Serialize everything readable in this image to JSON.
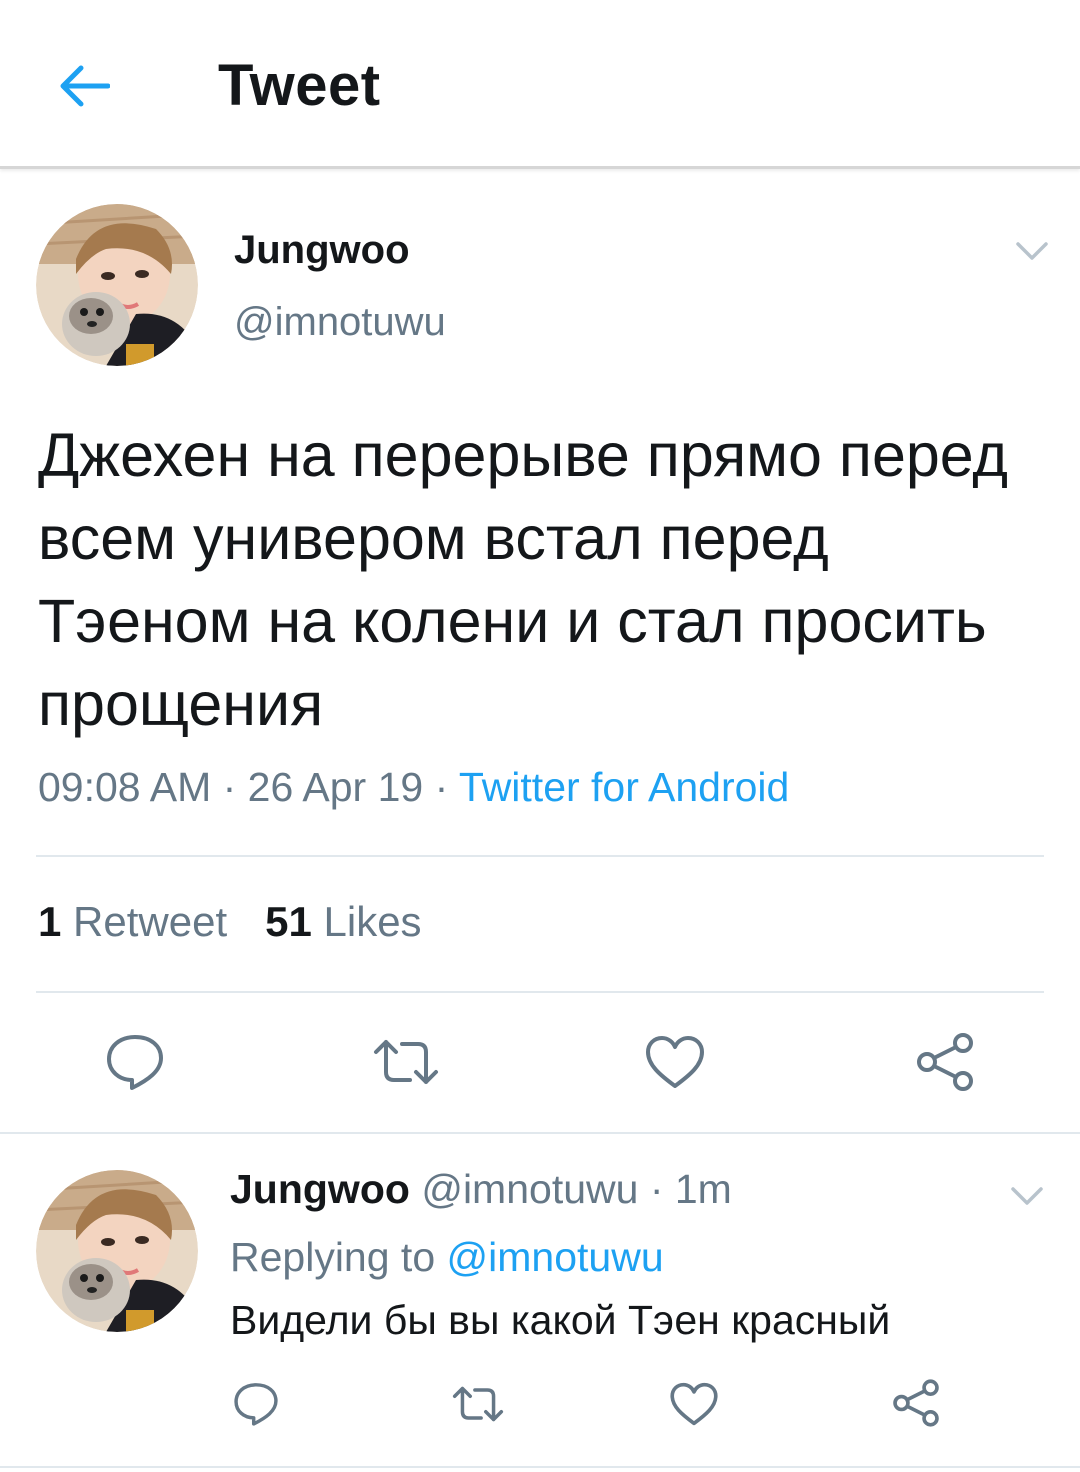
{
  "header": {
    "title": "Tweet",
    "back_icon": "arrow-left-icon"
  },
  "colors": {
    "accent": "#1da1f2",
    "text_primary": "#14171a",
    "text_secondary": "#657786",
    "divider": "#e1e8ed"
  },
  "tweet": {
    "author_name": "Jungwoo",
    "author_handle": "@imnotuwu",
    "text": "Джехен на перерыве прямо перед всем универом встал перед Тэеном на колени и стал просить прощения",
    "time": "09:08 AM",
    "separator": " · ",
    "date": "26 Apr 19",
    "source": "Twitter for Android",
    "retweet_count": "1",
    "retweet_label": "Retweet",
    "likes_count": "51",
    "likes_label": "Likes",
    "actions": [
      "reply-icon",
      "retweet-icon",
      "like-icon",
      "share-icon"
    ]
  },
  "reply": {
    "author_name": "Jungwoo",
    "author_handle": "@imnotuwu",
    "separator": " · ",
    "time": "1m",
    "replying_to_label": "Replying to",
    "replying_to_handle": "@imnotuwu",
    "text": "Видели бы вы какой Тэен красный",
    "actions": [
      "reply-icon",
      "retweet-icon",
      "like-icon",
      "share-icon"
    ]
  }
}
